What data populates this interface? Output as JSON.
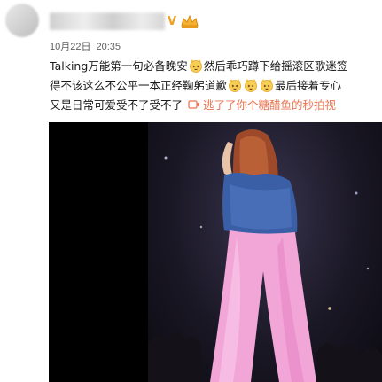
{
  "post": {
    "date": "10月22日",
    "time": "20:35",
    "verified_icon": "v-verified-icon",
    "vip_icon": "vip-badge-icon",
    "text_line1_a": "Talking万能第一句必备晚安",
    "text_line1_b": "然后乖巧蹲下给摇滚区歌迷签",
    "text_line2_a": "得不该这么不公平一本正经鞠躬道歉",
    "text_line2_b": "最后接着专心",
    "text_line3_a": "又是日常可爱受不了受不了",
    "link_text": "逃了了你个糖醋鱼的秒拍视",
    "emoji_icon": "cat-face-emoji-icon",
    "link_icon": "video-link-icon"
  },
  "media": {
    "type": "video-still",
    "scene": "stage-performer-back-view"
  },
  "colors": {
    "link": "#eb7350",
    "verified": "#f0a020",
    "text": "#1a1a1a",
    "meta": "#5f5f5f"
  }
}
